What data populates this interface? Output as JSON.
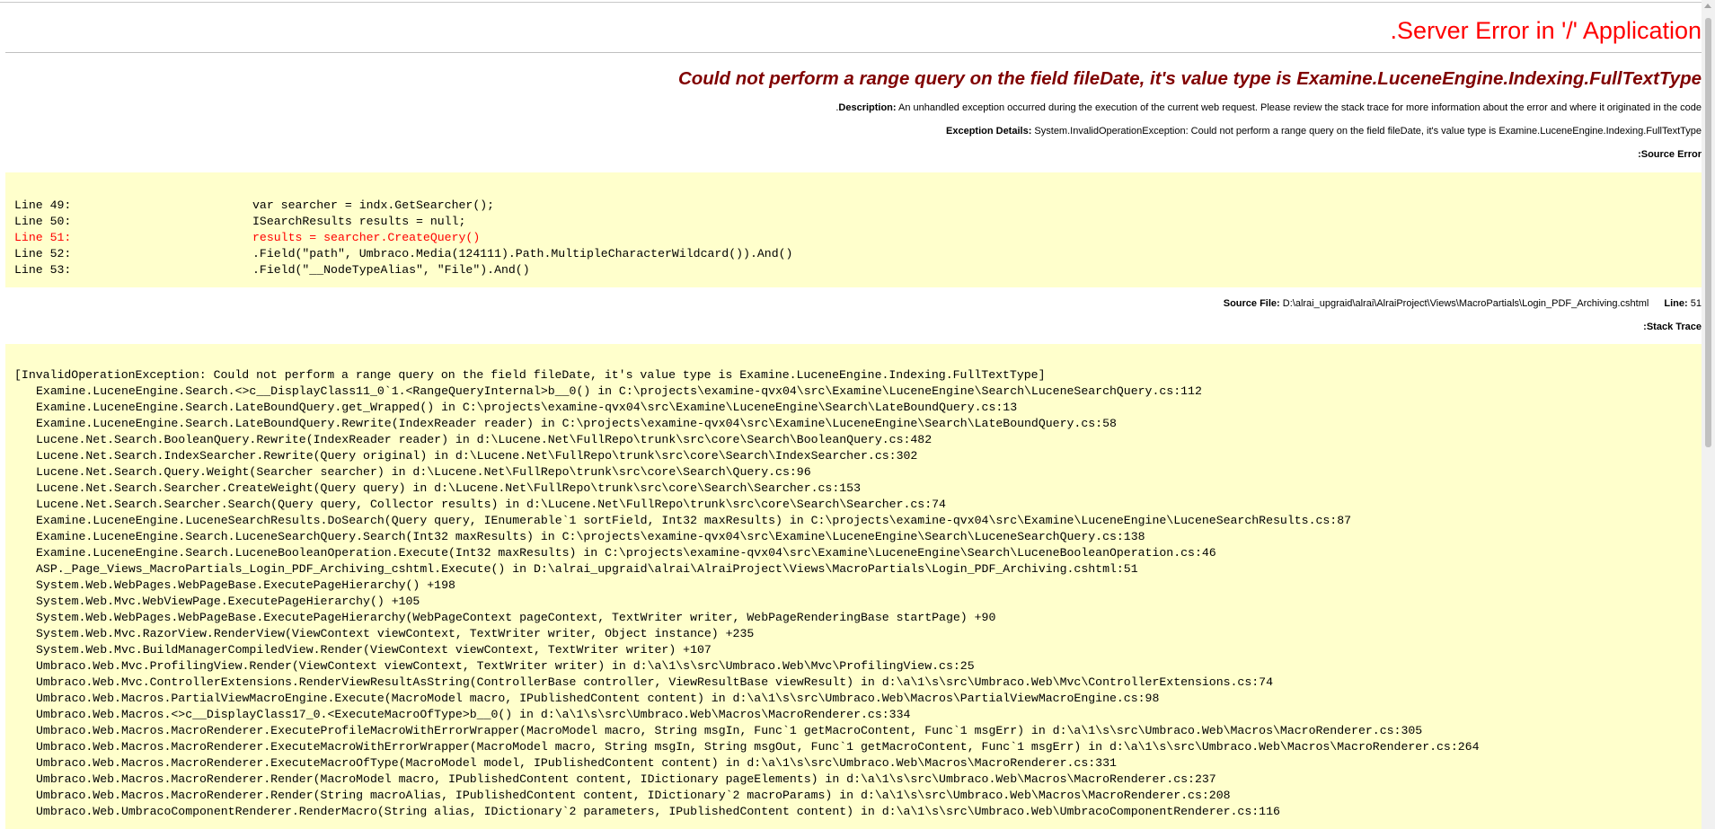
{
  "title": "Server Error in '/' Application.",
  "subtitle": "Could not perform a range query on the field fileDate, it's value type is Examine.LuceneEngine.Indexing.FullTextType",
  "description": {
    "label": "Description:",
    "text": "An unhandled exception occurred during the execution of the current web request. Please review the stack trace for more information about the error and where it originated in the code."
  },
  "exception": {
    "label": "Exception Details:",
    "text": "System.InvalidOperationException: Could not perform a range query on the field fileDate, it's value type is Examine.LuceneEngine.Indexing.FullTextType"
  },
  "source_error_label": "Source Error:",
  "source_lines": [
    {
      "num": "Line 49:",
      "code": "var searcher = indx.GetSearcher();",
      "error": false
    },
    {
      "num": "Line 50:",
      "code": "ISearchResults results = null;",
      "error": false
    },
    {
      "num": "Line 51:",
      "code": "results = searcher.CreateQuery()",
      "error": true
    },
    {
      "num": "Line 52:",
      "code": ".Field(\"path\", Umbraco.Media(124111).Path.MultipleCharacterWildcard()).And()",
      "error": false
    },
    {
      "num": "Line 53:",
      "code": ".Field(\"__NodeTypeAlias\", \"File\").And()",
      "error": false
    }
  ],
  "source_file": {
    "label": "Source File:",
    "path": "D:\\alrai_upgraid\\alrai\\AlraiProject\\Views\\MacroPartials\\Login_PDF_Archiving.cshtml",
    "line_label": "Line:",
    "line_value": "51"
  },
  "stack_trace_label": "Stack Trace:",
  "stack_trace": [
    "[InvalidOperationException: Could not perform a range query on the field fileDate, it's value type is Examine.LuceneEngine.Indexing.FullTextType]",
    "Examine.LuceneEngine.Search.<>c__DisplayClass11_0`1.<RangeQueryInternal>b__0() in C:\\projects\\examine-qvx04\\src\\Examine\\LuceneEngine\\Search\\LuceneSearchQuery.cs:112",
    "Examine.LuceneEngine.Search.LateBoundQuery.get_Wrapped() in C:\\projects\\examine-qvx04\\src\\Examine\\LuceneEngine\\Search\\LateBoundQuery.cs:13",
    "Examine.LuceneEngine.Search.LateBoundQuery.Rewrite(IndexReader reader) in C:\\projects\\examine-qvx04\\src\\Examine\\LuceneEngine\\Search\\LateBoundQuery.cs:58",
    "Lucene.Net.Search.BooleanQuery.Rewrite(IndexReader reader) in d:\\Lucene.Net\\FullRepo\\trunk\\src\\core\\Search\\BooleanQuery.cs:482",
    "Lucene.Net.Search.IndexSearcher.Rewrite(Query original) in d:\\Lucene.Net\\FullRepo\\trunk\\src\\core\\Search\\IndexSearcher.cs:302",
    "Lucene.Net.Search.Query.Weight(Searcher searcher) in d:\\Lucene.Net\\FullRepo\\trunk\\src\\core\\Search\\Query.cs:96",
    "Lucene.Net.Search.Searcher.CreateWeight(Query query) in d:\\Lucene.Net\\FullRepo\\trunk\\src\\core\\Search\\Searcher.cs:153",
    "Lucene.Net.Search.Searcher.Search(Query query, Collector results) in d:\\Lucene.Net\\FullRepo\\trunk\\src\\core\\Search\\Searcher.cs:74",
    "Examine.LuceneEngine.LuceneSearchResults.DoSearch(Query query, IEnumerable`1 sortField, Int32 maxResults) in C:\\projects\\examine-qvx04\\src\\Examine\\LuceneEngine\\LuceneSearchResults.cs:87",
    "Examine.LuceneEngine.Search.LuceneSearchQuery.Search(Int32 maxResults) in C:\\projects\\examine-qvx04\\src\\Examine\\LuceneEngine\\Search\\LuceneSearchQuery.cs:138",
    "Examine.LuceneEngine.Search.LuceneBooleanOperation.Execute(Int32 maxResults) in C:\\projects\\examine-qvx04\\src\\Examine\\LuceneEngine\\Search\\LuceneBooleanOperation.cs:46",
    "ASP._Page_Views_MacroPartials_Login_PDF_Archiving_cshtml.Execute() in D:\\alrai_upgraid\\alrai\\AlraiProject\\Views\\MacroPartials\\Login_PDF_Archiving.cshtml:51",
    "System.Web.WebPages.WebPageBase.ExecutePageHierarchy() +198",
    "System.Web.Mvc.WebViewPage.ExecutePageHierarchy() +105",
    "System.Web.WebPages.WebPageBase.ExecutePageHierarchy(WebPageContext pageContext, TextWriter writer, WebPageRenderingBase startPage) +90",
    "System.Web.Mvc.RazorView.RenderView(ViewContext viewContext, TextWriter writer, Object instance) +235",
    "System.Web.Mvc.BuildManagerCompiledView.Render(ViewContext viewContext, TextWriter writer) +107",
    "Umbraco.Web.Mvc.ProfilingView.Render(ViewContext viewContext, TextWriter writer) in d:\\a\\1\\s\\src\\Umbraco.Web\\Mvc\\ProfilingView.cs:25",
    "Umbraco.Web.Mvc.ControllerExtensions.RenderViewResultAsString(ControllerBase controller, ViewResultBase viewResult) in d:\\a\\1\\s\\src\\Umbraco.Web\\Mvc\\ControllerExtensions.cs:74",
    "Umbraco.Web.Macros.PartialViewMacroEngine.Execute(MacroModel macro, IPublishedContent content) in d:\\a\\1\\s\\src\\Umbraco.Web\\Macros\\PartialViewMacroEngine.cs:98",
    "Umbraco.Web.Macros.<>c__DisplayClass17_0.<ExecuteMacroOfType>b__0() in d:\\a\\1\\s\\src\\Umbraco.Web\\Macros\\MacroRenderer.cs:334",
    "Umbraco.Web.Macros.MacroRenderer.ExecuteProfileMacroWithErrorWrapper(MacroModel macro, String msgIn, Func`1 getMacroContent, Func`1 msgErr) in d:\\a\\1\\s\\src\\Umbraco.Web\\Macros\\MacroRenderer.cs:305",
    "Umbraco.Web.Macros.MacroRenderer.ExecuteMacroWithErrorWrapper(MacroModel macro, String msgIn, String msgOut, Func`1 getMacroContent, Func`1 msgErr) in d:\\a\\1\\s\\src\\Umbraco.Web\\Macros\\MacroRenderer.cs:264",
    "Umbraco.Web.Macros.MacroRenderer.ExecuteMacroOfType(MacroModel model, IPublishedContent content) in d:\\a\\1\\s\\src\\Umbraco.Web\\Macros\\MacroRenderer.cs:331",
    "Umbraco.Web.Macros.MacroRenderer.Render(MacroModel macro, IPublishedContent content, IDictionary pageElements) in d:\\a\\1\\s\\src\\Umbraco.Web\\Macros\\MacroRenderer.cs:237",
    "Umbraco.Web.Macros.MacroRenderer.Render(String macroAlias, IPublishedContent content, IDictionary`2 macroParams) in d:\\a\\1\\s\\src\\Umbraco.Web\\Macros\\MacroRenderer.cs:208",
    "Umbraco.Web.UmbracoComponentRenderer.RenderMacro(String alias, IDictionary`2 parameters, IPublishedContent content) in d:\\a\\1\\s\\src\\Umbraco.Web\\UmbracoComponentRenderer.cs:116"
  ]
}
